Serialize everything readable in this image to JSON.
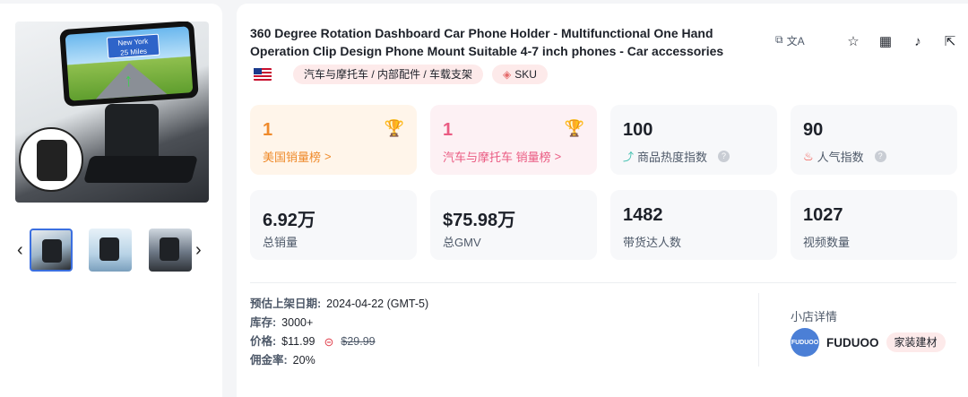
{
  "gallery": {
    "main_image_sign_line1": "New York",
    "main_image_sign_line2": "25 Miles",
    "prev_icon": "chevron-left-icon",
    "next_icon": "chevron-right-icon",
    "thumbnails": [
      "product-thumb-1",
      "product-thumb-2",
      "product-thumb-3"
    ],
    "selected_thumbnail": 1
  },
  "product": {
    "title": "360 Degree Rotation Dashboard Car Phone Holder - Multifunctional One Hand Operation Clip Design Phone Mount Suitable 4-7 inch phones - Car accessories",
    "flag": "us-flag-icon",
    "category_path": "汽车与摩托车 / 内部配件 / 车载支架",
    "sku_label": "SKU"
  },
  "actions": {
    "icons": [
      "copy-icon",
      "translate-icon",
      "star-icon",
      "qrcode-icon",
      "tiktok-icon",
      "external-link-icon"
    ]
  },
  "stats": {
    "us_rank": {
      "value": "1",
      "label": "美国销量榜",
      "arrow": ">"
    },
    "category_rank": {
      "value": "1",
      "label": "汽车与摩托车 销量榜",
      "arrow": ">"
    },
    "heat_index": {
      "value": "100",
      "label": "商品热度指数"
    },
    "popularity_index": {
      "value": "90",
      "label": "人气指数"
    },
    "total_sales": {
      "value": "6.92万",
      "label": "总销量"
    },
    "gmv": {
      "value": "$75.98万",
      "label": "总GMV"
    },
    "creators": {
      "value": "1482",
      "label": "带货达人数"
    },
    "videos": {
      "value": "1027",
      "label": "视频数量"
    }
  },
  "details": {
    "listing_date_label": "预估上架日期:",
    "listing_date": "2024-04-22 (GMT-5)",
    "stock_label": "库存:",
    "stock": "3000+",
    "price_label": "价格:",
    "price": "$11.99",
    "original_price": "$29.99",
    "commission_label": "佣金率:",
    "commission": "20%"
  },
  "shop": {
    "section_title": "小店详情",
    "logo_text": "FUDUOO",
    "name": "FUDUOO",
    "category": "家装建材"
  },
  "colors": {
    "accent_orange": "#ef8a2b",
    "accent_pink": "#ea5b82",
    "tag_bg": "#fdeaea",
    "shop_logo": "#4b7fd6"
  }
}
